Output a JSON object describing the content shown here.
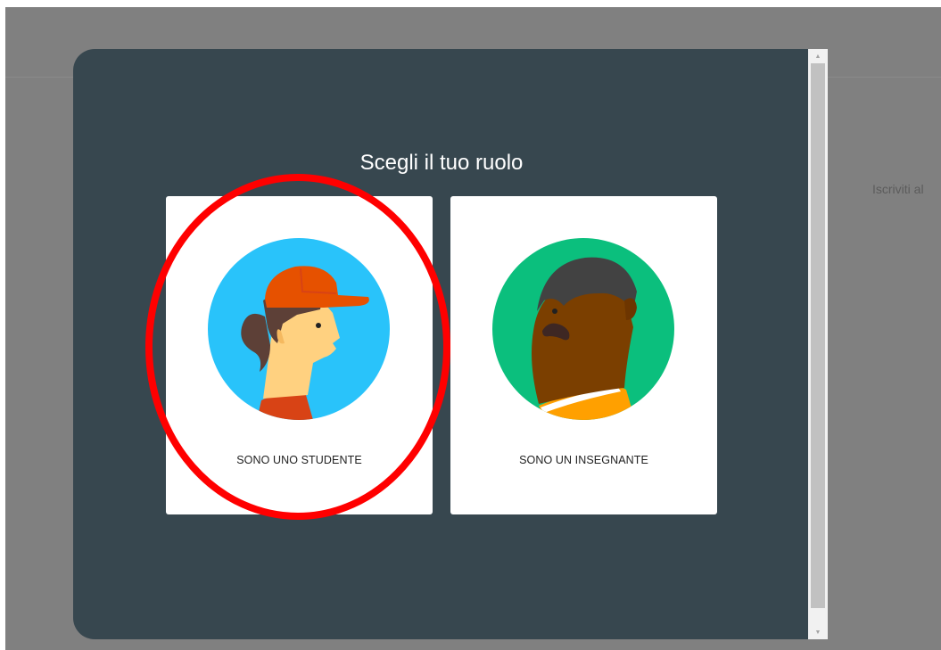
{
  "background": {
    "partial_text": "Iscriviti al"
  },
  "dialog": {
    "title": "Scegli il tuo ruolo",
    "roles": [
      {
        "label": "SONO UNO STUDENTE",
        "icon": "student-avatar-icon"
      },
      {
        "label": "SONO UN INSEGNANTE",
        "icon": "teacher-avatar-icon"
      }
    ]
  },
  "annotation": {
    "highlight_color": "#ff0000",
    "highlighted_role": "SONO UNO STUDENTE"
  },
  "colors": {
    "dialog_bg": "#37474f",
    "student_circle": "#29c3fa",
    "teacher_circle": "#0bbf7d",
    "cap": "#e65100"
  }
}
